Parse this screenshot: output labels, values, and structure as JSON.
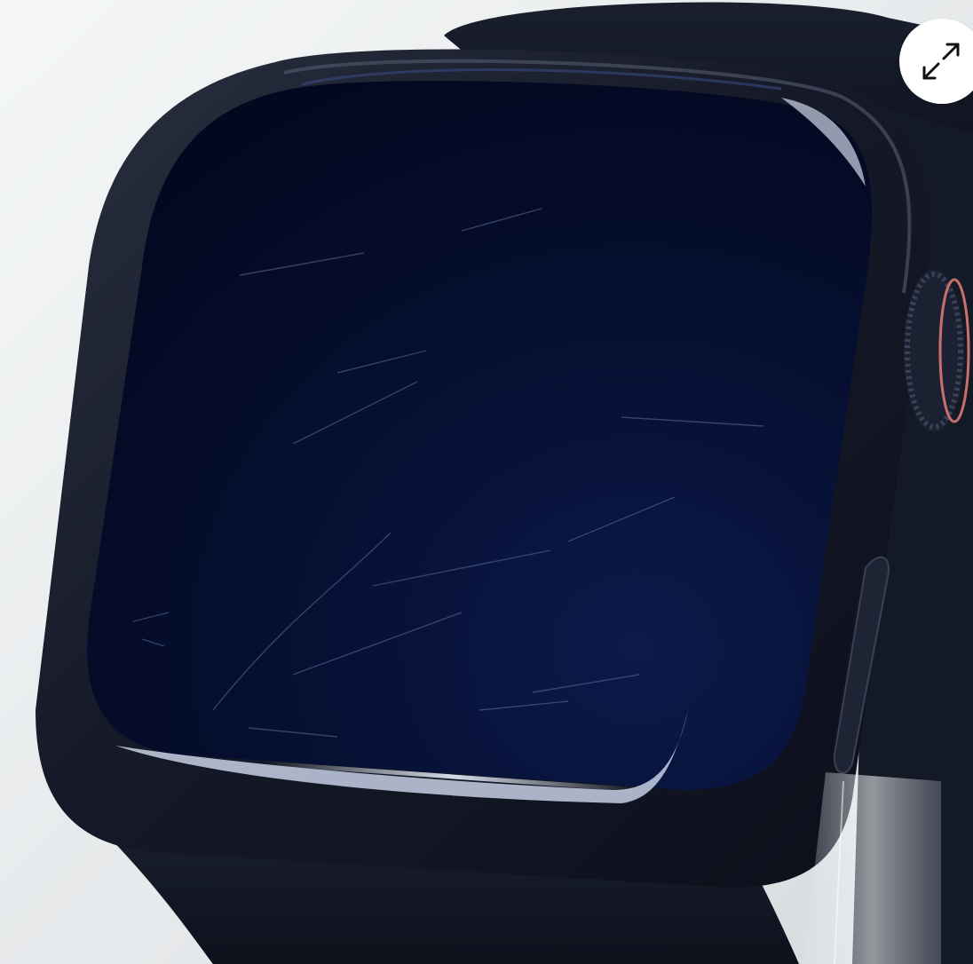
{
  "photo": {
    "subject": "smartwatch-with-scratched-screen",
    "colors": {
      "background": "#e9ecee",
      "case": "#15192a",
      "screen": "#040a24",
      "band": "#101522",
      "crown_accent": "#c76f6a"
    }
  },
  "controls": {
    "expand_icon": "expand-arrows-icon"
  }
}
